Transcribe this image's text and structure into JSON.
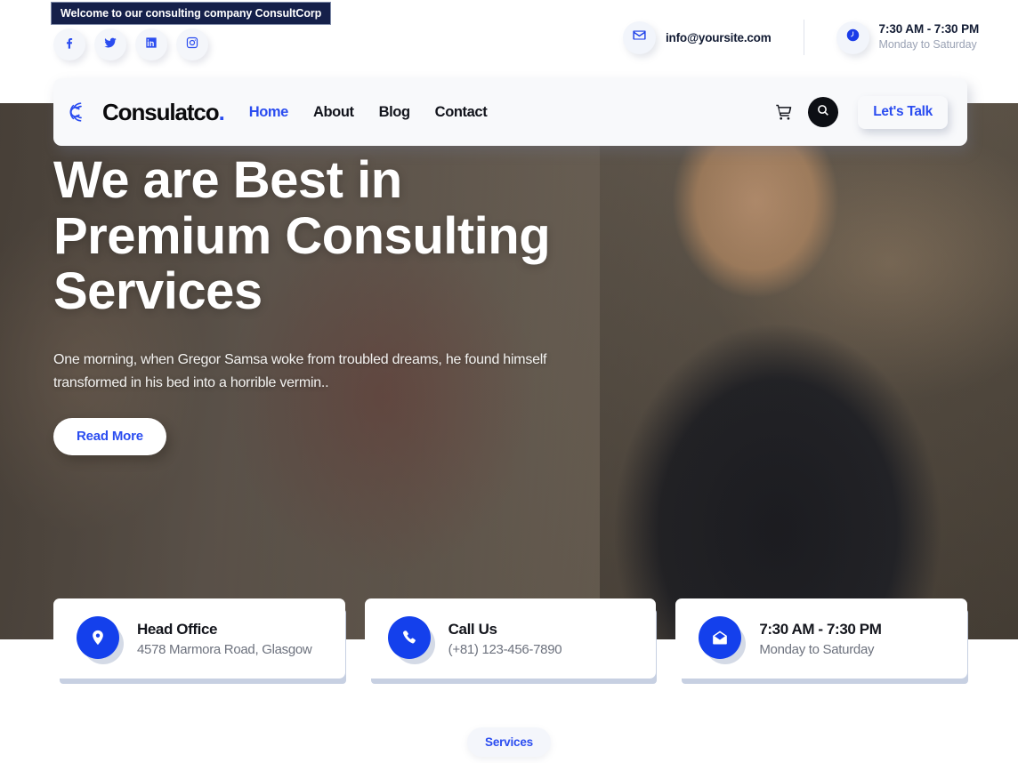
{
  "topbar": {
    "welcome_text": "Welcome to our consulting company ConsultCorp",
    "social": [
      {
        "name": "facebook",
        "label": "Facebook"
      },
      {
        "name": "twitter",
        "label": "Twitter"
      },
      {
        "name": "linkedin",
        "label": "LinkedIn"
      },
      {
        "name": "instagram",
        "label": "Instagram"
      }
    ],
    "email": "info@yoursite.com",
    "hours_main": "7:30 AM - 7:30 PM",
    "hours_sub": "Monday to Saturday"
  },
  "nav": {
    "brand": "Consulatco",
    "brand_dot": ".",
    "links": [
      {
        "label": "Home",
        "active": true
      },
      {
        "label": "About",
        "active": false
      },
      {
        "label": "Blog",
        "active": false
      },
      {
        "label": "Contact",
        "active": false
      }
    ],
    "cta_label": "Let's Talk"
  },
  "hero": {
    "badge": "We are",
    "title_line1": "We are Best in",
    "title_line2": "Premium Consulting",
    "title_line3": "Services",
    "paragraph": "One morning, when Gregor Samsa woke from troubled dreams, he found himself transformed in his bed into a horrible vermin..",
    "button_label": "Read More"
  },
  "cards": [
    {
      "icon": "location-pin-icon",
      "title": "Head Office",
      "sub": "4578 Marmora Road, Glasgow"
    },
    {
      "icon": "phone-icon",
      "title": "Call Us",
      "sub": "(+81) 123-456-7890"
    },
    {
      "icon": "envelope-open-icon",
      "title": "7:30 AM - 7:30 PM",
      "sub": "Monday to Saturday"
    }
  ],
  "services_pill": "Services",
  "colors": {
    "primary_blue": "#2b4df0",
    "icon_blue": "#1440ec",
    "banner_navy": "#15204a",
    "dark": "#0d0f14",
    "muted": "#6d727e"
  }
}
